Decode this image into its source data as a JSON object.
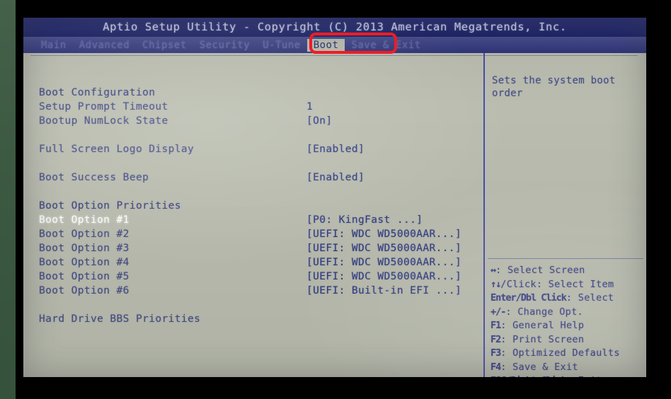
{
  "window": {
    "title": "Aptio Setup Utility - Copyright (C) 2013 American Megatrends, Inc."
  },
  "menu": {
    "items": [
      {
        "label": "Main",
        "active": false
      },
      {
        "label": "Advanced",
        "active": false
      },
      {
        "label": "Chipset",
        "active": false
      },
      {
        "label": "Security",
        "active": false
      },
      {
        "label": "U-Tune",
        "active": false
      },
      {
        "label": "Boot",
        "active": true
      },
      {
        "label": "Save & Exit",
        "active": false
      }
    ]
  },
  "settings": [
    {
      "label": "Boot Configuration",
      "value": "",
      "type": "header",
      "selected": false
    },
    {
      "label": "Setup Prompt Timeout",
      "value": "1",
      "type": "item",
      "selected": false
    },
    {
      "label": "Bootup NumLock State",
      "value": "[On]",
      "type": "item",
      "selected": false
    },
    {
      "label": "Full Screen Logo Display",
      "value": "[Enabled]",
      "type": "item",
      "selected": false
    },
    {
      "label": "Boot Success Beep",
      "value": "[Enabled]",
      "type": "item",
      "selected": false
    },
    {
      "label": "Boot Option Priorities",
      "value": "",
      "type": "header",
      "selected": false
    },
    {
      "label": "Boot Option #1",
      "value": "[P0: KingFast      ...]",
      "type": "item",
      "selected": true
    },
    {
      "label": "Boot Option #2",
      "value": "[UEFI: WDC WD5000AAR...]",
      "type": "item",
      "selected": false
    },
    {
      "label": "Boot Option #3",
      "value": "[UEFI: WDC WD5000AAR...]",
      "type": "item",
      "selected": false
    },
    {
      "label": "Boot Option #4",
      "value": "[UEFI: WDC WD5000AAR...]",
      "type": "item",
      "selected": false
    },
    {
      "label": "Boot Option #5",
      "value": "[UEFI: WDC WD5000AAR...]",
      "type": "item",
      "selected": false
    },
    {
      "label": "Boot Option #6",
      "value": "[UEFI: Built-in EFI ...]",
      "type": "item",
      "selected": false
    },
    {
      "label": "Hard Drive BBS Priorities",
      "value": "",
      "type": "submenu",
      "selected": false
    }
  ],
  "help": {
    "description": "Sets the system boot order",
    "legend": [
      {
        "keys": "↔",
        "action": ": Select Screen"
      },
      {
        "keys": "↑↓",
        "action": "/Click: Select Item"
      },
      {
        "keys": "Enter/Dbl Click",
        "action": ": Select"
      },
      {
        "keys": "+/-",
        "action": ": Change Opt."
      },
      {
        "keys": "F1",
        "action": ": General Help"
      },
      {
        "keys": "F2",
        "action": ": Print Screen"
      },
      {
        "keys": "F3",
        "action": ": Optimized Defaults"
      },
      {
        "keys": "F4",
        "action": ": Save & Exit"
      },
      {
        "keys": "ESC/Right Click",
        "action": ": Exit"
      }
    ]
  },
  "annotation": {
    "target": "Boot",
    "color": "#ee1c25"
  }
}
